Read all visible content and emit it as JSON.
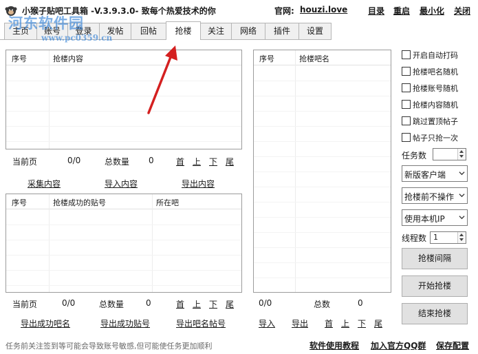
{
  "app": {
    "title": "小猴子贴吧工具箱 -V.3.9.3.0- 致每个热爱技术的你",
    "site_label": "官网:",
    "site_url": "houzi.love",
    "top_links": [
      "目录",
      "重启",
      "最小化",
      "关闭"
    ]
  },
  "watermark": {
    "text": "河东软件园",
    "url": "www.pc0359.cn"
  },
  "tabs": [
    "主页",
    "账号",
    "登录",
    "发帖",
    "回帖",
    "抢楼",
    "关注",
    "网络",
    "插件",
    "设置"
  ],
  "active_tab": "抢楼",
  "content_list": {
    "columns": [
      "序号",
      "抢楼内容"
    ],
    "current_page_label": "当前页",
    "current_page": "0/0",
    "total_label": "总数量",
    "total": "0",
    "pager": [
      "首",
      "上",
      "下",
      "尾"
    ],
    "actions": [
      "采集内容",
      "导入内容",
      "导出内容"
    ]
  },
  "success_list": {
    "columns": [
      "序号",
      "抢楼成功的贴号",
      "所在吧"
    ],
    "current_page_label": "当前页",
    "current_page": "0/0",
    "total_label": "总数量",
    "total": "0",
    "pager": [
      "首",
      "上",
      "下",
      "尾"
    ],
    "actions": [
      "导出成功吧名",
      "导出成功贴号",
      "导出吧名帖号"
    ]
  },
  "bar_list": {
    "columns": [
      "序号",
      "抢楼吧名"
    ],
    "current_page": "0/0",
    "total_label": "总数",
    "total": "0",
    "actions": [
      "导入",
      "导出"
    ],
    "pager": [
      "首",
      "上",
      "下",
      "尾"
    ]
  },
  "options": {
    "checkboxes": [
      "开启自动打码",
      "抢楼吧名随机",
      "抢楼账号随机",
      "抢楼内容随机",
      "跳过置顶帖子",
      "帖子只抢一次"
    ],
    "task_count_label": "任务数",
    "task_count": "",
    "client_select": "新版客户端",
    "pre_action_select": "抢楼前不操作",
    "ip_select": "使用本机IP",
    "thread_label": "线程数",
    "thread_count": "1"
  },
  "buttons": {
    "interval": "抢楼间隔",
    "start": "开始抢楼",
    "stop": "结束抢楼"
  },
  "status_bar": {
    "message": "任务前关注签到等可能会导致账号敏感,但可能使任务更加顺利",
    "links": [
      "软件使用教程",
      "加入官方QQ群",
      "保存配置"
    ]
  },
  "colors": {
    "watermark": "#2f7fd6",
    "arrow": "#d42020"
  }
}
